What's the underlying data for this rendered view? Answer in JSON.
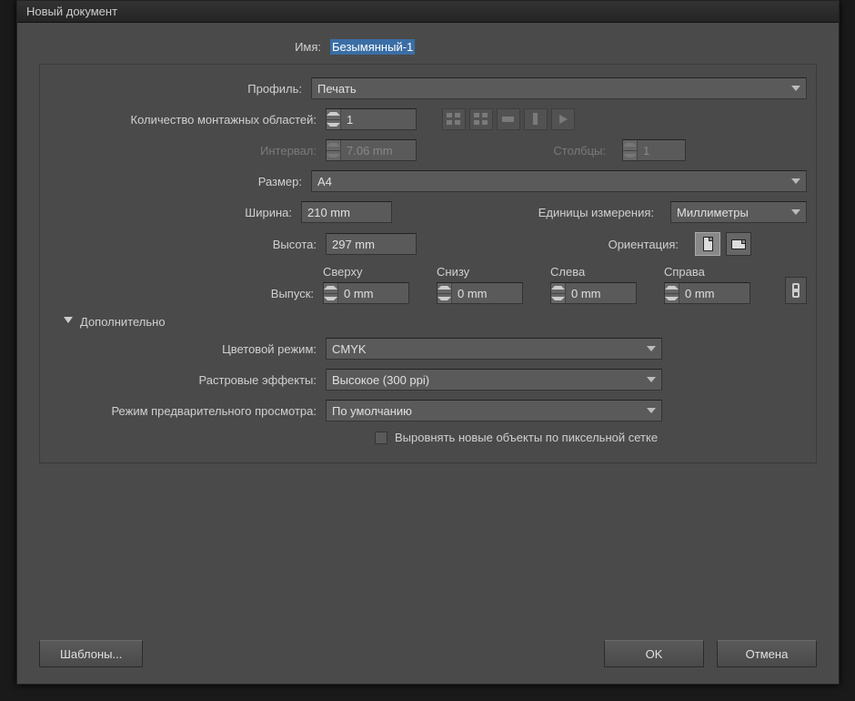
{
  "window": {
    "title": "Новый документ"
  },
  "fields": {
    "name_label": "Имя:",
    "name_value": "Безымянный-1",
    "profile_label": "Профиль:",
    "profile_value": "Печать",
    "artboards_label": "Количество монтажных областей:",
    "artboards_value": "1",
    "spacing_label": "Интервал:",
    "spacing_value": "7.06 mm",
    "columns_label": "Столбцы:",
    "columns_value": "1",
    "size_label": "Размер:",
    "size_value": "A4",
    "width_label": "Ширина:",
    "width_value": "210 mm",
    "height_label": "Высота:",
    "height_value": "297 mm",
    "units_label": "Единицы измерения:",
    "units_value": "Миллиметры",
    "orientation_label": "Ориентация:",
    "bleed_label": "Выпуск:",
    "bleed": {
      "top_label": "Сверху",
      "top_value": "0 mm",
      "bottom_label": "Снизу",
      "bottom_value": "0 mm",
      "left_label": "Слева",
      "left_value": "0 mm",
      "right_label": "Справа",
      "right_value": "0 mm"
    }
  },
  "advanced": {
    "toggle_label": "Дополнительно",
    "color_mode_label": "Цветовой режим:",
    "color_mode_value": "CMYK",
    "raster_label": "Растровые эффекты:",
    "raster_value": "Высокое (300 ppi)",
    "preview_label": "Режим предварительного просмотра:",
    "preview_value": "По умолчанию",
    "align_pixel_label": "Выровнять новые объекты по пиксельной сетке"
  },
  "buttons": {
    "templates": "Шаблоны...",
    "ok": "OK",
    "cancel": "Отмена"
  }
}
